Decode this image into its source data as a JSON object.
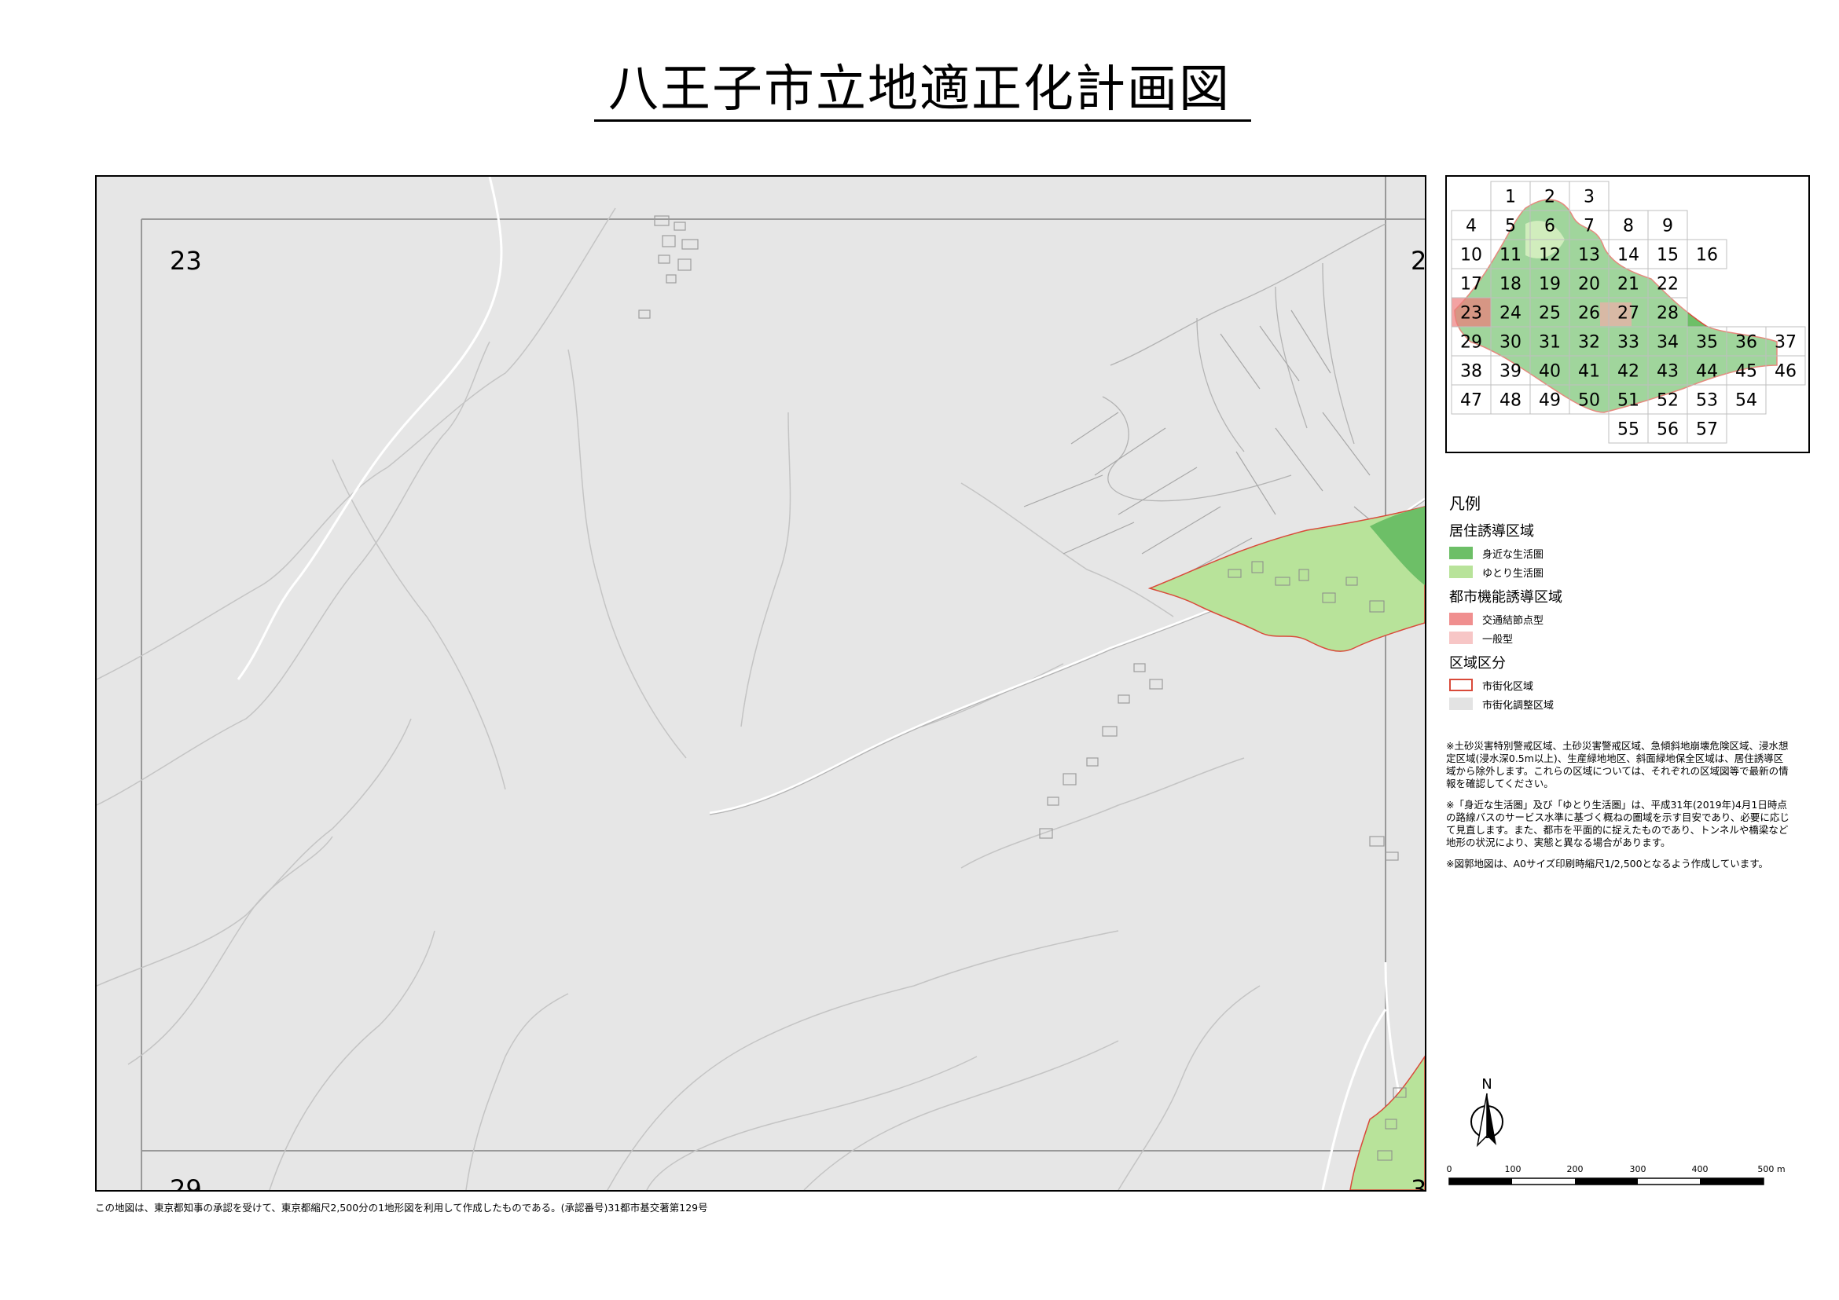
{
  "title": "八王子市立地適正化計画図",
  "map": {
    "sheet_numbers": {
      "main": "23",
      "top_right": "2",
      "bottom_left": "29",
      "bottom_right": "3"
    }
  },
  "index_map": {
    "cells": [
      "1",
      "2",
      "3",
      "4",
      "5",
      "6",
      "7",
      "8",
      "9",
      "10",
      "11",
      "12",
      "13",
      "14",
      "15",
      "16",
      "17",
      "18",
      "19",
      "20",
      "21",
      "22",
      "23",
      "24",
      "25",
      "26",
      "27",
      "28",
      "29",
      "30",
      "31",
      "32",
      "33",
      "34",
      "35",
      "36",
      "37",
      "38",
      "39",
      "40",
      "41",
      "42",
      "43",
      "44",
      "45",
      "46",
      "47",
      "48",
      "49",
      "50",
      "51",
      "52",
      "53",
      "54",
      "55",
      "56",
      "57"
    ],
    "highlight": "23"
  },
  "legend": {
    "title": "凡例",
    "groups": [
      {
        "label": "居住誘導区域",
        "items": [
          {
            "label": "身近な生活圏",
            "color": "#6dbf67"
          },
          {
            "label": "ゆとり生活圏",
            "color": "#b8e39a"
          }
        ]
      },
      {
        "label": "都市機能誘導区域",
        "items": [
          {
            "label": "交通結節点型",
            "color": "#f08f8f"
          },
          {
            "label": "一般型",
            "color": "#f7c6c6"
          }
        ]
      },
      {
        "label": "区域区分",
        "items": [
          {
            "label": "市街化区域",
            "color": "#ffffff",
            "border": "#d94a3a"
          },
          {
            "label": "市街化調整区域",
            "color": "#e3e3e3"
          }
        ]
      }
    ]
  },
  "notes": [
    "※土砂災害特別警戒区域、土砂災害警戒区域、急傾斜地崩壊危険区域、浸水想定区域(浸水深0.5m以上)、生産緑地地区、斜面緑地保全区域は、居住誘導区域から除外します。これらの区域については、それぞれの区域図等で最新の情報を確認してください。",
    "※「身近な生活圏」及び「ゆとり生活圏」は、平成31年(2019年)4月1日時点の路線バスのサービス水準に基づく概ねの圏域を示す目安であり、必要に応じて見直します。また、都市を平面的に捉えたものであり、トンネルや橋梁など地形の状況により、実態と異なる場合があります。",
    "※図郭地図は、A0サイズ印刷時縮尺1/2,500となるよう作成しています。"
  ],
  "north_label": "N",
  "scale": {
    "labels": [
      "0",
      "100",
      "200",
      "300",
      "400",
      "500 m"
    ]
  },
  "credit": "この地図は、東京都知事の承認を受けて、東京都縮尺2,500分の1地形図を利用して作成したものである。(承認番号)31都市基交著第129号"
}
